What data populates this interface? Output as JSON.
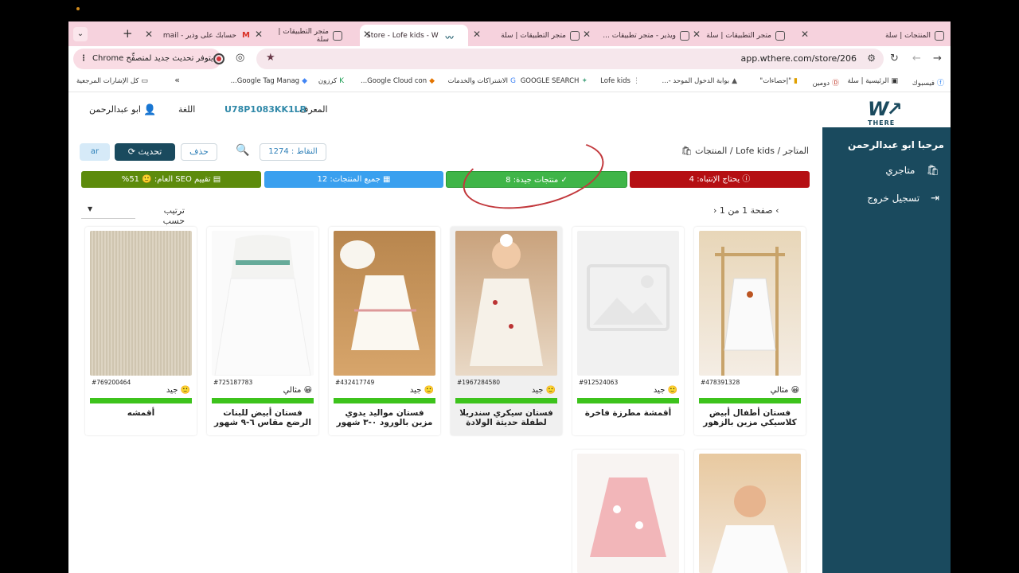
{
  "browser": {
    "tabs": [
      {
        "title": "المنتجات | سلة",
        "active": false
      },
      {
        "title": "متجر التطبيقات | سلة",
        "active": false
      },
      {
        "title": "ويذير - متجر تطبيقات ...",
        "active": false
      },
      {
        "title": "متجر التطبيقات | سلة",
        "active": false
      },
      {
        "title": "Store - Lofe kids - W",
        "active": true
      },
      {
        "title": "متجر التطبيقات | سلة",
        "active": false
      },
      {
        "title": "حسابك على وذير - mail",
        "active": false
      }
    ],
    "url": "app.wthere.com/store/206",
    "update_chip": "يتوفر تحديث جديد لمتصفِّح Chrome",
    "bookmarks": [
      {
        "label": "فيسبوك",
        "icon": "f"
      },
      {
        "label": "الرئيسية | سلة",
        "icon": "▣"
      },
      {
        "label": "دومين",
        "icon": "D"
      },
      {
        "label": "\"إحصاءات\"",
        "icon": "▮"
      },
      {
        "label": "بوابة الدخول الموحد -...",
        "icon": "▲"
      },
      {
        "label": "Lofe kids",
        "icon": "⋮"
      },
      {
        "label": "GOOGLE SEARCH",
        "icon": "✦"
      },
      {
        "label": "الاشتراكات والخدمات",
        "icon": "G"
      },
      {
        "label": "Google Cloud con...",
        "icon": "◆"
      },
      {
        "label": "كرزون",
        "icon": "K"
      },
      {
        "label": "Google Tag Manag...",
        "icon": "◆"
      },
      {
        "label": "»",
        "icon": ""
      },
      {
        "label": "كل الإشارات المرجعية",
        "icon": "▭"
      }
    ]
  },
  "header": {
    "id_label": "المعرف",
    "id_value": "U78P1083KK1LR",
    "language_label": "اللغة",
    "user_name": "ابو عبدالرحمن"
  },
  "sidebar": {
    "greeting": "مرحبا ابو عبدالرحمن",
    "items": [
      {
        "label": "متاجري",
        "icon": "bag-icon"
      },
      {
        "label": "تسجيل خروج",
        "icon": "logout-icon"
      }
    ]
  },
  "toolbar": {
    "lang": "ar",
    "refresh": "تحديث",
    "delete": "حذف",
    "points": "النقاط : 1274",
    "breadcrumb": "المتاجر / Lofe kids / المنتجات"
  },
  "stats": {
    "attention": "يحتاج الإنتباه: 4",
    "good": "منتجات جيدة: 8",
    "all": "جميع المنتجات: 12",
    "seo": "تقييم SEO العام: 🙂 51%",
    "colors": {
      "attention": "#b50f13",
      "good": "#3fb548",
      "all": "#3aa0ef",
      "seo": "#5d8b0c"
    }
  },
  "pager": {
    "text": "صفحة 1 من 1"
  },
  "sort": {
    "label": "ترتيب حسب"
  },
  "products": [
    {
      "sku": "#478391328",
      "grade": "😀 مثالي",
      "name": "فستان أطفال أبيض كلاسيكي مزين بالزهور"
    },
    {
      "sku": "#912524063",
      "grade": "🙂 جيد",
      "name": "أقمشة مطرزة فاخرة"
    },
    {
      "sku": "#1967284580",
      "grade": "🙂 جيد",
      "name": "فستان سيكري سندريلا لطفلة حديثة الولادة"
    },
    {
      "sku": "#432417749",
      "grade": "🙂 جيد",
      "name": "فستان مواليد يدوي مزين بالورود ٠-٣ شهور"
    },
    {
      "sku": "#725187783",
      "grade": "😀 مثالي",
      "name": "فستان أبيض للبنات الرضع مقاس ٦-٩ شهور"
    },
    {
      "sku": "#769200464",
      "grade": "🙂 جيد",
      "name": "أقمشه"
    }
  ]
}
